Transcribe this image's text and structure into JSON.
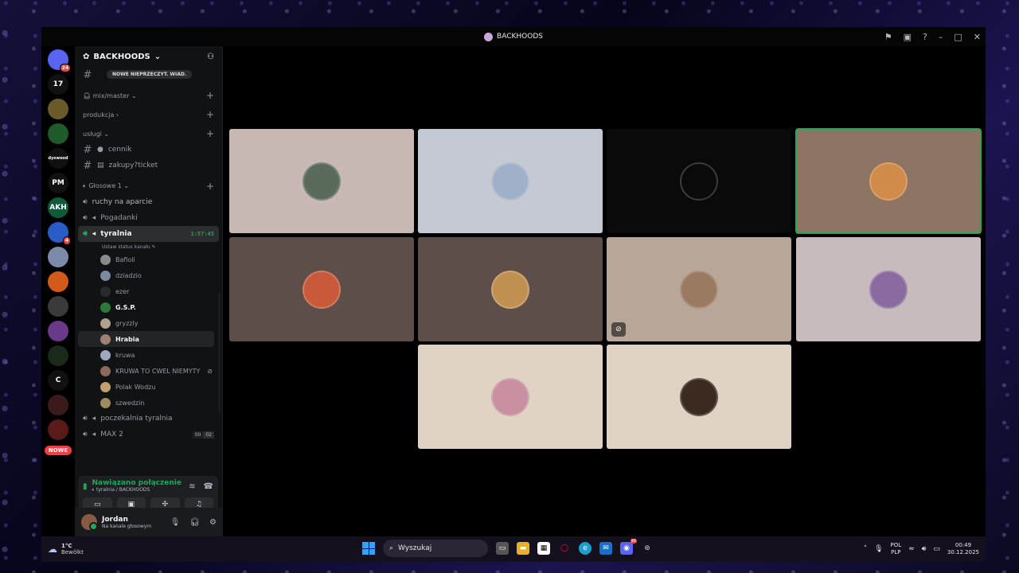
{
  "window": {
    "title": "BACKHOODS"
  },
  "server": {
    "name": "BACKHOODS",
    "new_messages_pill": "NOWE NIEPRZECZYT. WIAD."
  },
  "rail": {
    "items": [
      {
        "label": "",
        "badge": "24",
        "color": "#5865f2"
      },
      {
        "label": "17",
        "badge": "",
        "color": "#111111"
      },
      {
        "label": "",
        "badge": "",
        "color": "#6a5a2a"
      },
      {
        "label": "",
        "badge": "",
        "color": "#1f5a2a"
      },
      {
        "label": "dyswood",
        "badge": "",
        "color": "#111111"
      },
      {
        "label": "PM",
        "badge": "",
        "color": "#111111"
      },
      {
        "label": "AKH",
        "badge": "",
        "color": "#0e5a3a"
      },
      {
        "label": "",
        "badge": "4",
        "color": "#2a5cc8"
      },
      {
        "label": "",
        "badge": "",
        "color": "#7a8aa8"
      },
      {
        "label": "",
        "badge": "",
        "color": "#d25a1a"
      },
      {
        "label": "",
        "badge": "",
        "color": "#3a3a3a"
      },
      {
        "label": "",
        "badge": "",
        "color": "#6a3a8a"
      },
      {
        "label": "",
        "badge": "",
        "color": "#1a2a1a"
      },
      {
        "label": "C",
        "badge": "",
        "color": "#111111"
      },
      {
        "label": "",
        "badge": "",
        "color": "#3a1a1a"
      },
      {
        "label": "",
        "badge": "",
        "color": "#5a1a1a"
      }
    ],
    "nowe_label": "NOWE"
  },
  "sidebar": {
    "categories": {
      "mix": "mix/master",
      "produkcja": "produkcja",
      "uslugi": "usługi",
      "glosowe": "Głosowe 1"
    },
    "text_channels": {
      "cennik": "cennik",
      "zakupy": "zakupy?ticket"
    },
    "voice_channels": {
      "ruchy": "ruchy na aparcie",
      "pogadanki": "Pogadanki",
      "tyralnia": "tyralnia",
      "tyralnia_time": "1:57:45",
      "status_prompt": "Ustaw status kanału",
      "poczekalnia": "poczekalnia tyralnia",
      "max2": "MAX 2",
      "max2_count_a": "00",
      "max2_count_b": "02"
    },
    "members": [
      {
        "name": "Bafioli",
        "bold": false,
        "color": "#8a8a8a"
      },
      {
        "name": "dziadzio",
        "bold": false,
        "color": "#7a8aa0"
      },
      {
        "name": "ezer",
        "bold": false,
        "color": "#2a2a2a"
      },
      {
        "name": "G.S.P.",
        "bold": true,
        "color": "#2a7a3a"
      },
      {
        "name": "gryzzly",
        "bold": false,
        "color": "#b0a090"
      },
      {
        "name": "Hrabia",
        "bold": true,
        "color": "#a08070"
      },
      {
        "name": "kruwa",
        "bold": false,
        "color": "#a0a8c0"
      },
      {
        "name": "KRUWA TO CWEL NIEMYTY",
        "bold": false,
        "color": "#8a6a5a"
      },
      {
        "name": "Polak Wodzu",
        "bold": false,
        "color": "#c0a070"
      },
      {
        "name": "szwedzin",
        "bold": false,
        "color": "#a08a60"
      }
    ]
  },
  "connection": {
    "state": "Nawiązano połączenie",
    "location": "tyralnia / BACKHOODS"
  },
  "user": {
    "name": "Jordan",
    "status": "Na kanale głosowym"
  },
  "tiles": [
    {
      "bg": "#c8b8b3",
      "face": "#5a6a5a",
      "speaking": false,
      "muted": false
    },
    {
      "bg": "#c5cad2",
      "face": "#9fb0c8",
      "speaking": false,
      "muted": false
    },
    {
      "bg": "#0a0a0a",
      "face": "#0a0a0a",
      "speaking": false,
      "muted": false
    },
    {
      "bg": "#8e7462",
      "face": "#d08a4a",
      "speaking": true,
      "muted": false
    },
    {
      "bg": "#5e4e4a",
      "face": "#c85a3a",
      "speaking": false,
      "muted": false
    },
    {
      "bg": "#5e4e4a",
      "face": "#c09050",
      "speaking": false,
      "muted": false
    },
    {
      "bg": "#b8a698",
      "face": "#9a7a60",
      "speaking": false,
      "muted": true
    },
    {
      "bg": "#c6bcbc",
      "face": "#8a6aa0",
      "speaking": false,
      "muted": false
    },
    {
      "bg": "#e0d3c4",
      "face": "#c890a0",
      "speaking": false,
      "muted": false
    },
    {
      "bg": "#e0d3c4",
      "face": "#3a2a20",
      "speaking": false,
      "muted": false
    }
  ],
  "taskbar": {
    "temp": "1°C",
    "condition": "Bewölkt",
    "search_placeholder": "Wyszukaj",
    "lang_top": "POL",
    "lang_bottom": "PLP",
    "time": "00:49",
    "date": "30.12.2025",
    "discord_badge": "99"
  }
}
